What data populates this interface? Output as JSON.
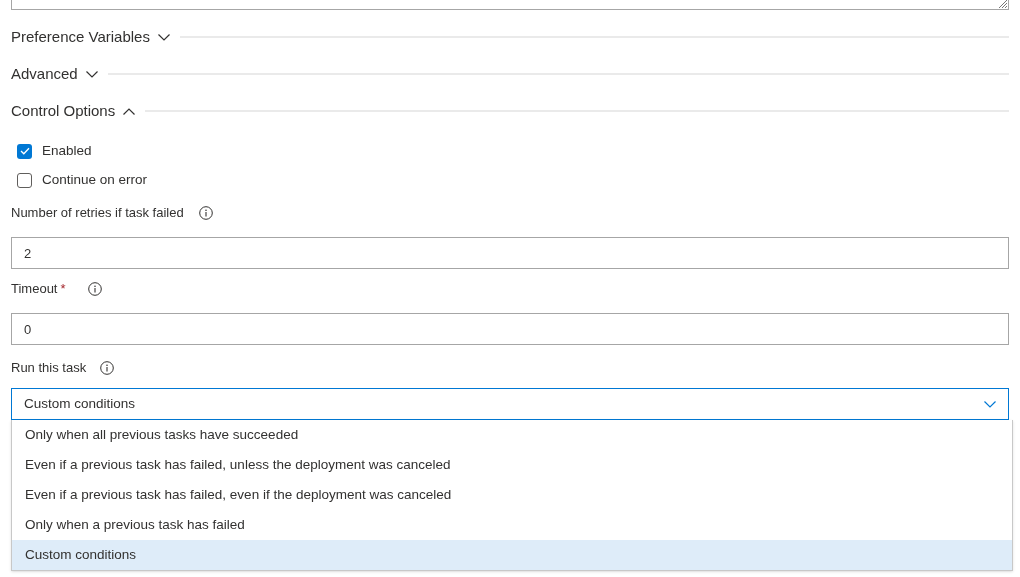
{
  "sections": [
    {
      "title": "Preference Variables",
      "expanded": false
    },
    {
      "title": "Advanced",
      "expanded": false
    },
    {
      "title": "Control Options",
      "expanded": true
    }
  ],
  "checkboxes": [
    {
      "label": "Enabled",
      "checked": true
    },
    {
      "label": "Continue on error",
      "checked": false
    }
  ],
  "fields": [
    {
      "label": "Number of retries if task failed",
      "value": "2"
    },
    {
      "label": "Timeout",
      "required_mark": "*",
      "value": "0"
    }
  ],
  "run_this_task": {
    "label": "Run this task",
    "value": "Custom conditions",
    "options": [
      {
        "label": "Only when all previous tasks have succeeded",
        "selected": false
      },
      {
        "label": "Even if a previous task has failed, unless the deployment was canceled",
        "selected": false
      },
      {
        "label": "Even if a previous task has failed, even if the deployment was canceled",
        "selected": false
      },
      {
        "label": "Only when a previous task has failed",
        "selected": false
      },
      {
        "label": "Custom conditions",
        "selected": true
      }
    ]
  }
}
